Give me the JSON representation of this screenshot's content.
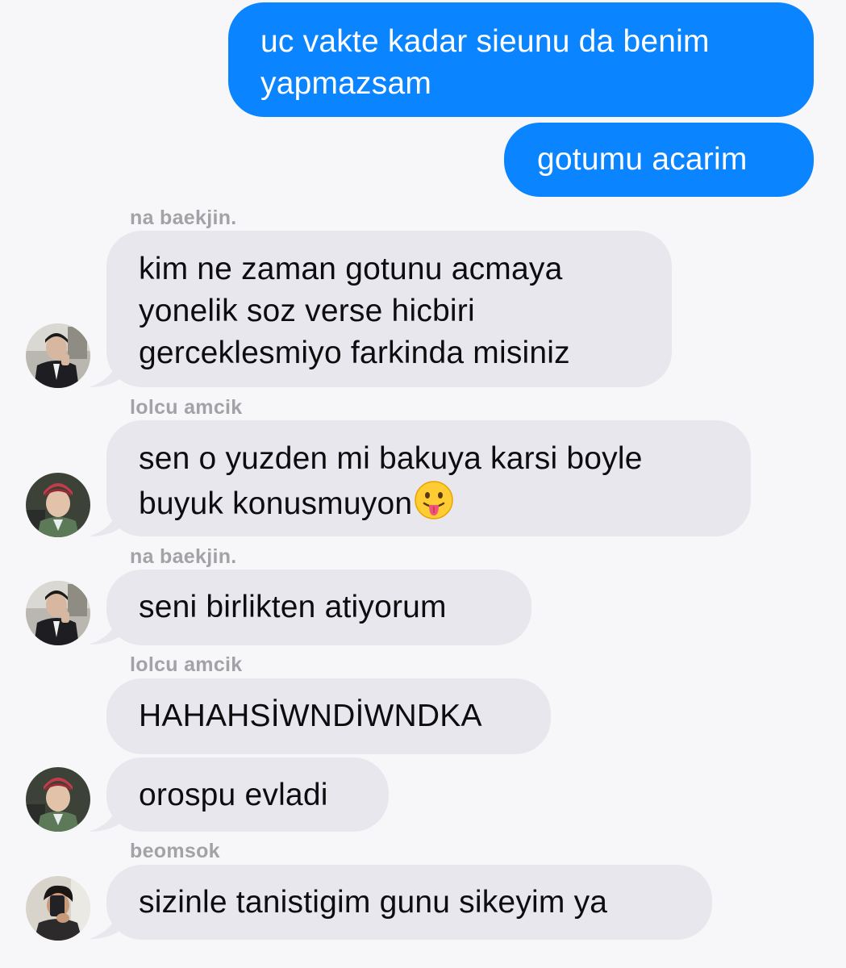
{
  "messages": [
    {
      "id": "m1",
      "direction": "outgoing",
      "text": "uc vakte kadar sieunu da benim yapmazsam"
    },
    {
      "id": "m2",
      "direction": "outgoing",
      "text": "gotumu acarim"
    },
    {
      "id": "m3",
      "direction": "incoming",
      "sender": "na baekjin.",
      "avatar": "avatar-man-suit",
      "text": "kim ne zaman gotunu acmaya yonelik soz verse hicbiri gerceklesmiyo farkinda misiniz"
    },
    {
      "id": "m4",
      "direction": "incoming",
      "sender": "lolcu amcik",
      "avatar": "avatar-man-bandana",
      "text": "sen o yuzden mi bakuya karsi boyle buyuk konusmuyon",
      "emoji": "face-with-tongue-emoji"
    },
    {
      "id": "m5",
      "direction": "incoming",
      "sender": "na baekjin.",
      "avatar": "avatar-man-suit",
      "text": "seni birlikten atiyorum"
    },
    {
      "id": "m6",
      "direction": "incoming",
      "sender": "lolcu amcik",
      "text": "HAHAHSİWNDİWNDKA"
    },
    {
      "id": "m7",
      "direction": "incoming",
      "avatar": "avatar-man-bandana",
      "text": "orospu evladi"
    },
    {
      "id": "m8",
      "direction": "incoming",
      "sender": "beomsok",
      "avatar": "avatar-man-mirror-selfie",
      "text": "sizinle tanistigim gunu sikeyim ya"
    }
  ],
  "colors": {
    "outgoing_bubble": "#0a84ff",
    "incoming_bubble": "#e8e7ed",
    "background": "#f7f7f9",
    "sender_name": "#a2a2a7"
  }
}
